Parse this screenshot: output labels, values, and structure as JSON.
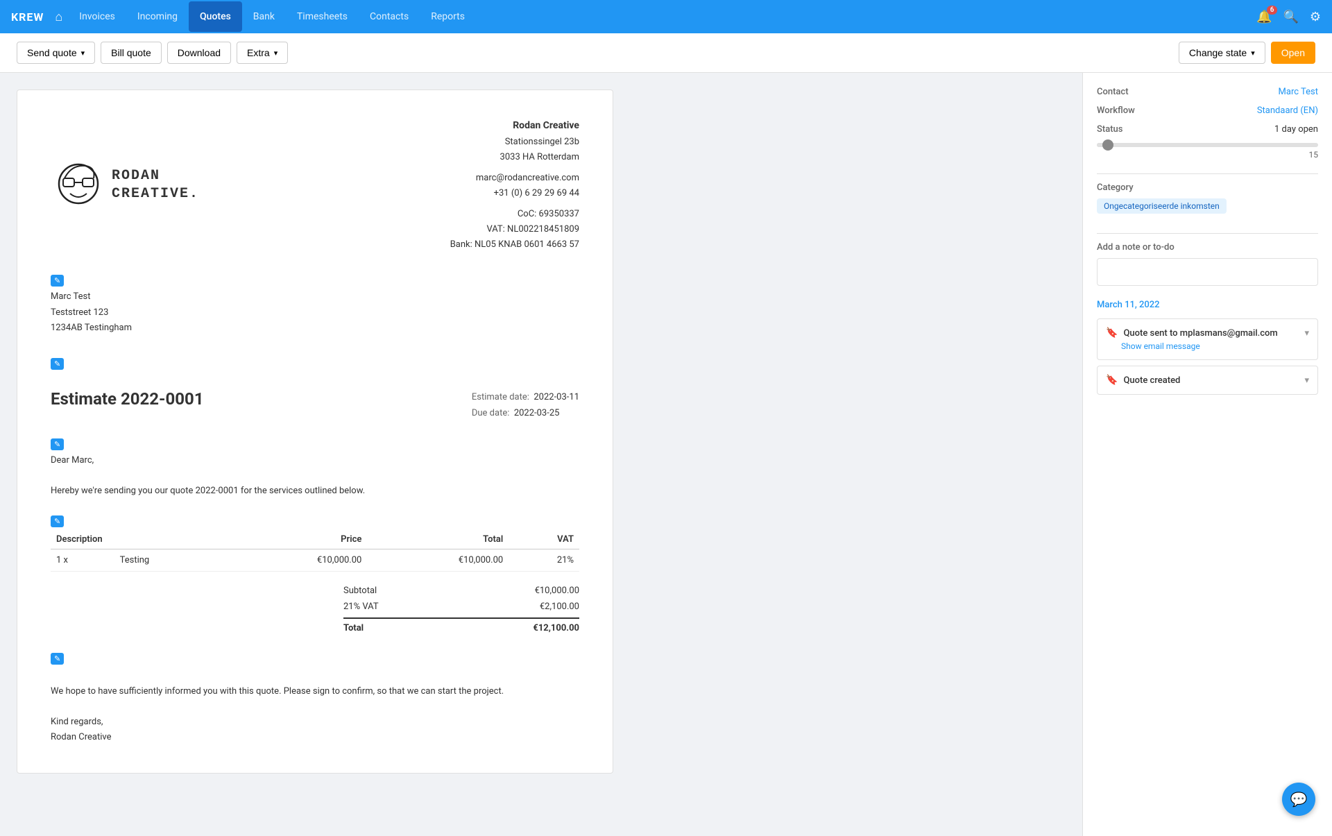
{
  "brand": "KREW",
  "nav": {
    "home_icon": "⌂",
    "links": [
      {
        "label": "Invoices",
        "active": false
      },
      {
        "label": "Incoming",
        "active": false
      },
      {
        "label": "Quotes",
        "active": true
      },
      {
        "label": "Bank",
        "active": false
      },
      {
        "label": "Timesheets",
        "active": false
      },
      {
        "label": "Contacts",
        "active": false
      },
      {
        "label": "Reports",
        "active": false
      }
    ],
    "notifications_count": "6",
    "search_icon": "🔍",
    "settings_icon": "⚙"
  },
  "toolbar": {
    "send_quote_label": "Send quote",
    "bill_quote_label": "Bill quote",
    "download_label": "Download",
    "extra_label": "Extra",
    "change_state_label": "Change state",
    "open_label": "Open"
  },
  "document": {
    "company_name": "Rodan Creative",
    "company_address_line1": "Stationssingel 23b",
    "company_address_line2": "3033 HA Rotterdam",
    "company_email": "marc@rodancreative.com",
    "company_phone": "+31 (0) 6 29 29 69 44",
    "company_coc": "CoC: 69350337",
    "company_vat": "VAT: NL002218451809",
    "company_bank": "Bank: NL05 KNAB 0601 4663 57",
    "recipient_name": "Marc Test",
    "recipient_address1": "Teststreet 123",
    "recipient_address2": "1234AB Testingham",
    "estimate_title": "Estimate 2022-0001",
    "estimate_date_label": "Estimate date:",
    "estimate_date_value": "2022-03-11",
    "due_date_label": "Due date:",
    "due_date_value": "2022-03-25",
    "intro_greeting": "Dear Marc,",
    "intro_body": "Hereby we're sending you our quote 2022-0001 for the services outlined below.",
    "table": {
      "col_description": "Description",
      "col_price": "Price",
      "col_total": "Total",
      "col_vat": "VAT",
      "rows": [
        {
          "qty": "1 x",
          "description": "Testing",
          "price": "€10,000.00",
          "total": "€10,000.00",
          "vat": "21%"
        }
      ],
      "subtotal_label": "Subtotal",
      "subtotal_value": "€10,000.00",
      "vat_label": "21% VAT",
      "vat_value": "€2,100.00",
      "total_label": "Total",
      "total_value": "€12,100.00"
    },
    "footer_line1": "We hope to have sufficiently informed you with this quote. Please sign to confirm, so that we can start the project.",
    "footer_line2": "Kind regards,",
    "footer_line3": "Rodan Creative"
  },
  "sidebar": {
    "contact_label": "Contact",
    "contact_value": "Marc Test",
    "workflow_label": "Workflow",
    "workflow_value": "Standaard (EN)",
    "status_label": "Status",
    "status_value": "1 day open",
    "slider_value": "15",
    "slider_percent": "5",
    "category_label": "Category",
    "category_badge": "Ongecategoriseerde inkomsten",
    "note_label": "Add a note or to-do",
    "note_placeholder": "",
    "date_section": "March 11, 2022",
    "timeline": [
      {
        "icon": "🔖",
        "text": "Quote sent to mplasmans@gmail.com",
        "has_expand": true,
        "sub_link": "Show email message"
      },
      {
        "icon": "🔖",
        "text": "Quote created",
        "has_expand": true,
        "sub_link": null
      }
    ]
  },
  "chat_icon": "💬"
}
